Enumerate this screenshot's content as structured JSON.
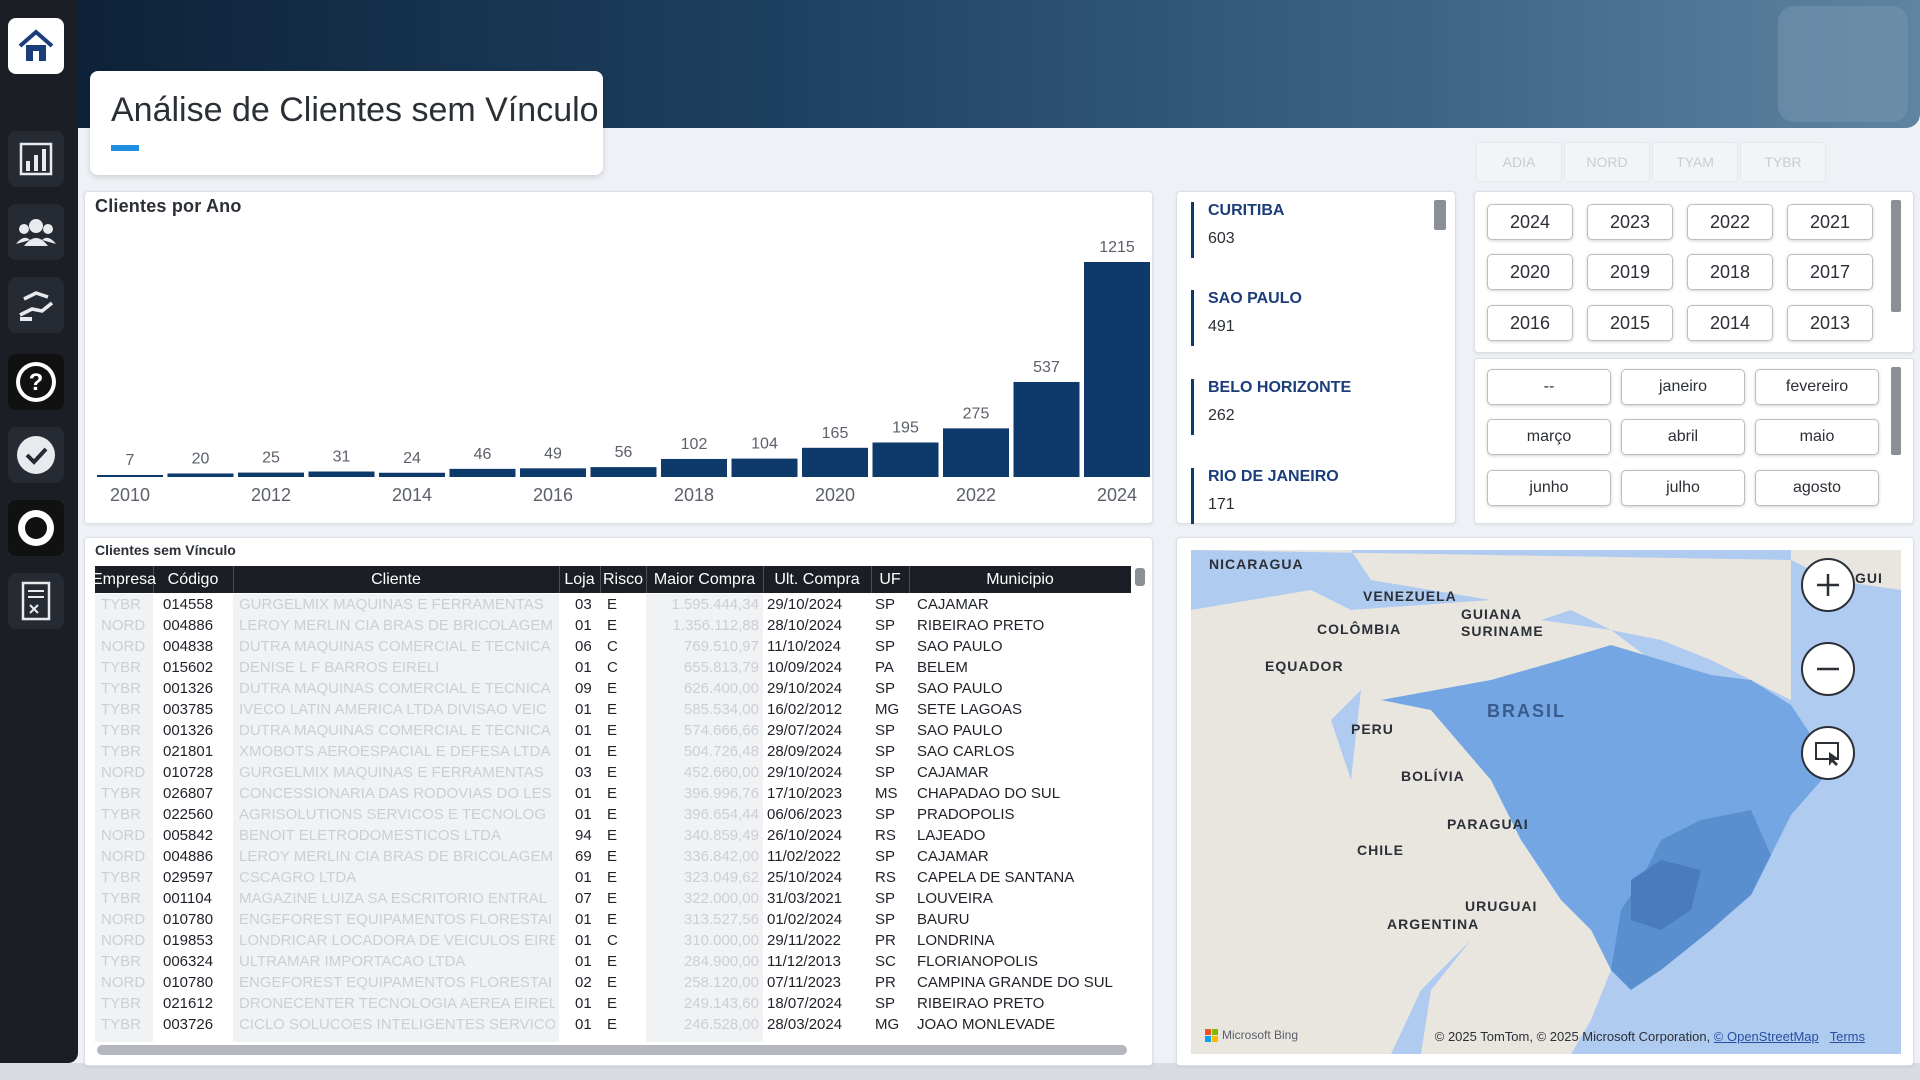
{
  "header": {
    "title": "Análise de Clientes sem Vínculo"
  },
  "nav": [
    {
      "name": "home-icon"
    },
    {
      "name": "bar-chart-icon"
    },
    {
      "name": "team-icon"
    },
    {
      "name": "handshake-icon"
    },
    {
      "name": "help-icon"
    },
    {
      "name": "check-icon"
    },
    {
      "name": "ring-icon"
    },
    {
      "name": "report-icon"
    }
  ],
  "chart_data": {
    "type": "bar",
    "title": "Clientes por Ano",
    "categories": [
      2010,
      2011,
      2012,
      2013,
      2014,
      2015,
      2016,
      2017,
      2018,
      2019,
      2020,
      2021,
      2022,
      2023,
      2024
    ],
    "values": [
      7,
      20,
      25,
      31,
      24,
      46,
      49,
      56,
      102,
      104,
      165,
      195,
      275,
      537,
      1215
    ],
    "x_tick_labels": [
      "2010",
      "2012",
      "2014",
      "2016",
      "2018",
      "2020",
      "2022",
      "2024"
    ],
    "bar_color": "#0d3a6b"
  },
  "cities": [
    {
      "name": "CURITIBA",
      "value": "603"
    },
    {
      "name": "SAO PAULO",
      "value": "491"
    },
    {
      "name": "BELO HORIZONTE",
      "value": "262"
    },
    {
      "name": "RIO DE JANEIRO",
      "value": "171"
    }
  ],
  "empresa_slicer": [
    "ADIA",
    "NORD",
    "TYAM",
    "TYBR"
  ],
  "years": [
    "2024",
    "2023",
    "2022",
    "2021",
    "2020",
    "2019",
    "2018",
    "2017",
    "2016",
    "2015",
    "2014",
    "2013"
  ],
  "months": [
    "--",
    "janeiro",
    "fevereiro",
    "março",
    "abril",
    "maio",
    "junho",
    "julho",
    "agosto"
  ],
  "table": {
    "title": "Clientes sem Vínculo",
    "columns": [
      "Empresa",
      "Código",
      "Cliente",
      "Loja",
      "Risco",
      "Maior Compra",
      "Ult. Compra",
      "UF",
      "Municipio"
    ],
    "rows": [
      [
        "TYBR",
        "014558",
        "GURGELMIX MAQUINAS E FERRAMENTAS",
        "03",
        "E",
        "1.595.444,34",
        "29/10/2024",
        "SP",
        "CAJAMAR"
      ],
      [
        "NORD",
        "004886",
        "LEROY MERLIN CIA BRAS DE BRICOLAGEM",
        "01",
        "E",
        "1.356.112,88",
        "28/10/2024",
        "SP",
        "RIBEIRAO PRETO"
      ],
      [
        "NORD",
        "004838",
        "DUTRA MAQUINAS COMERCIAL E TECNICA",
        "06",
        "C",
        "769.510,97",
        "11/10/2024",
        "SP",
        "SAO PAULO"
      ],
      [
        "TYBR",
        "015602",
        "DENISE L F BARROS EIRELI",
        "01",
        "C",
        "655.813,79",
        "10/09/2024",
        "PA",
        "BELEM"
      ],
      [
        "TYBR",
        "001326",
        "DUTRA MAQUINAS COMERCIAL E TECNICA",
        "09",
        "E",
        "626.400,00",
        "29/10/2024",
        "SP",
        "SAO PAULO"
      ],
      [
        "TYBR",
        "003785",
        "IVECO LATIN AMERICA LTDA DIVISAO VEIC",
        "01",
        "E",
        "585.534,00",
        "16/02/2012",
        "MG",
        "SETE LAGOAS"
      ],
      [
        "TYBR",
        "001326",
        "DUTRA MAQUINAS COMERCIAL E TECNICA",
        "01",
        "E",
        "574.666,66",
        "29/07/2024",
        "SP",
        "SAO PAULO"
      ],
      [
        "TYBR",
        "021801",
        "XMOBOTS AEROESPACIAL E DEFESA LTDA",
        "01",
        "E",
        "504.726,48",
        "28/09/2024",
        "SP",
        "SAO CARLOS"
      ],
      [
        "NORD",
        "010728",
        "GURGELMIX MAQUINAS E FERRAMENTAS",
        "03",
        "E",
        "452.660,00",
        "29/10/2024",
        "SP",
        "CAJAMAR"
      ],
      [
        "TYBR",
        "026807",
        "CONCESSIONARIA DAS RODOVIAS DO LES",
        "01",
        "E",
        "396.996,76",
        "17/10/2023",
        "MS",
        "CHAPADAO DO SUL"
      ],
      [
        "TYBR",
        "022560",
        "AGRISOLUTIONS SERVICOS E TECNOLOG",
        "01",
        "E",
        "396.654,44",
        "06/06/2023",
        "SP",
        "PRADOPOLIS"
      ],
      [
        "NORD",
        "005842",
        "BENOIT ELETRODOMESTICOS LTDA",
        "94",
        "E",
        "340.859,49",
        "26/10/2024",
        "RS",
        "LAJEADO"
      ],
      [
        "NORD",
        "004886",
        "LEROY MERLIN CIA BRAS DE BRICOLAGEM",
        "69",
        "E",
        "336.842,00",
        "11/02/2022",
        "SP",
        "CAJAMAR"
      ],
      [
        "TYBR",
        "029597",
        "CSCAGRO LTDA",
        "01",
        "E",
        "323.049,62",
        "25/10/2024",
        "RS",
        "CAPELA DE SANTANA"
      ],
      [
        "TYBR",
        "001104",
        "MAGAZINE LUIZA SA ESCRITORIO ENTRAL",
        "07",
        "E",
        "322.000,00",
        "31/03/2021",
        "SP",
        "LOUVEIRA"
      ],
      [
        "NORD",
        "010780",
        "ENGEFOREST EQUIPAMENTOS FLORESTAI",
        "01",
        "E",
        "313.527,56",
        "01/02/2024",
        "SP",
        "BAURU"
      ],
      [
        "NORD",
        "019853",
        "LONDRICAR LOCADORA DE VEICULOS EIRELI",
        "01",
        "C",
        "310.000,00",
        "29/11/2022",
        "PR",
        "LONDRINA"
      ],
      [
        "TYBR",
        "006324",
        "ULTRAMAR IMPORTACAO LTDA",
        "01",
        "E",
        "284.900,00",
        "11/12/2013",
        "SC",
        "FLORIANOPOLIS"
      ],
      [
        "NORD",
        "010780",
        "ENGEFOREST EQUIPAMENTOS FLORESTAI",
        "02",
        "E",
        "258.120,00",
        "07/11/2023",
        "PR",
        "CAMPINA GRANDE DO SUL"
      ],
      [
        "TYBR",
        "021612",
        "DRONECENTER TECNOLOGIA AEREA EIRELI",
        "01",
        "E",
        "249.143,60",
        "18/07/2024",
        "SP",
        "RIBEIRAO PRETO"
      ],
      [
        "TYBR",
        "003726",
        "CICLO SOLUCOES INTELIGENTES SERVICO",
        "01",
        "E",
        "246.528,00",
        "28/03/2024",
        "MG",
        "JOAO MONLEVADE"
      ]
    ]
  },
  "map": {
    "labels": [
      "NICARAGUA",
      "VENEZUELA",
      "GUIANA",
      "SURINAME",
      "COLÔMBIA",
      "EQUADOR",
      "BRASIL",
      "PERU",
      "BOLÍVIA",
      "PARAGUAI",
      "CHILE",
      "URUGUAI",
      "ARGENTINA",
      "GUI"
    ],
    "attribution_prefix": "© 2025 TomTom, © 2025 Microsoft Corporation, ",
    "attribution_link": "© OpenStreetMap",
    "terms": "Terms",
    "provider": "Microsoft Bing"
  }
}
